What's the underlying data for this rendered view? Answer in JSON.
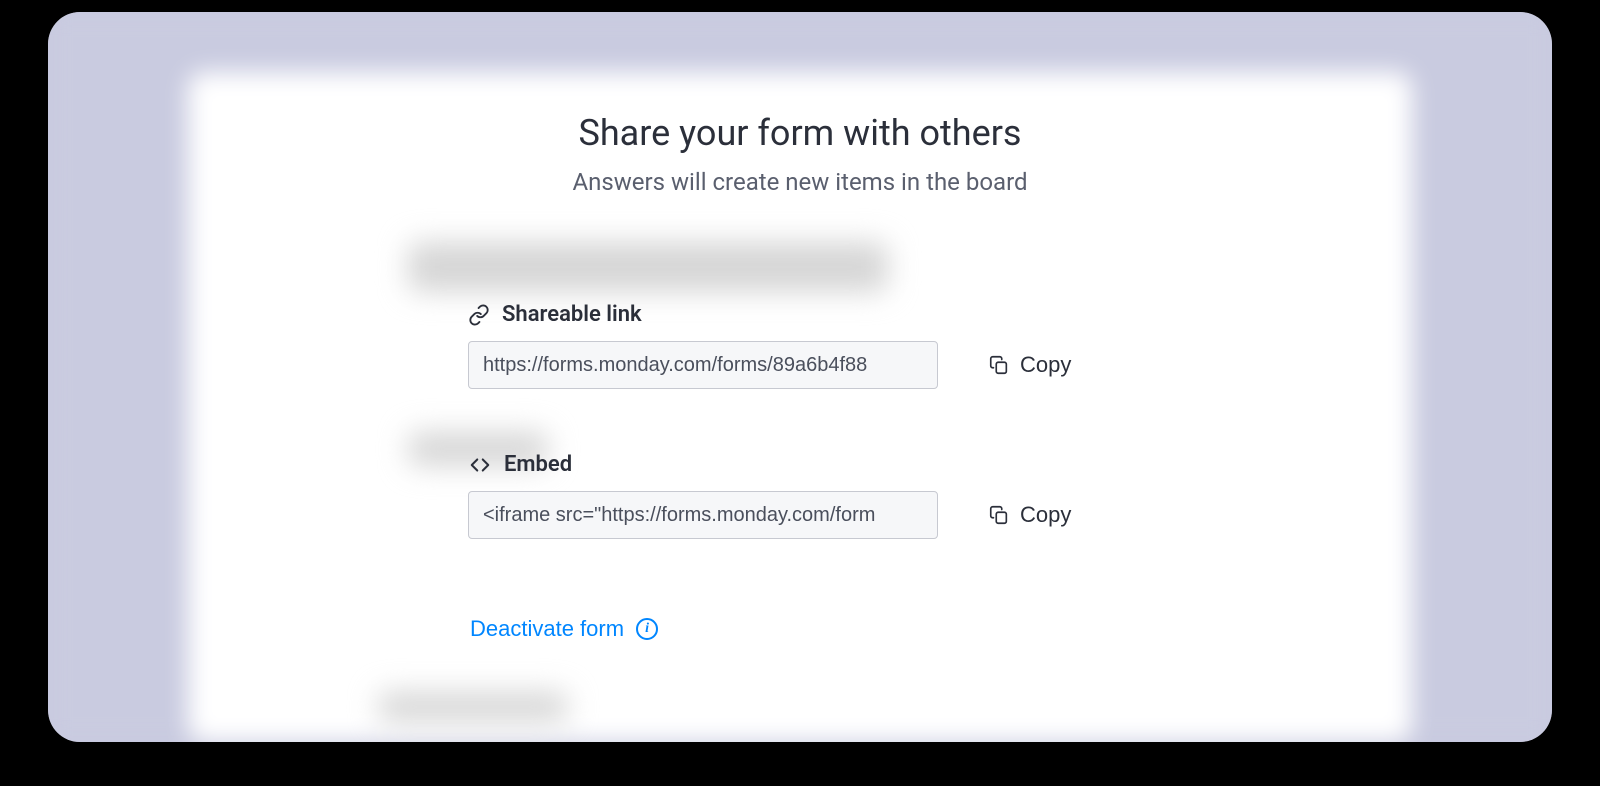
{
  "header": {
    "title": "Share your form with others",
    "subtitle": "Answers will create new items in the board"
  },
  "share": {
    "label": "Shareable link",
    "value": "https://forms.monday.com/forms/89a6b4f88",
    "copy_label": "Copy"
  },
  "embed": {
    "label": "Embed",
    "value": "<iframe src=\"https://forms.monday.com/form",
    "copy_label": "Copy"
  },
  "deactivate": {
    "label": "Deactivate form"
  },
  "colors": {
    "link": "#0086ff",
    "text": "#2b2f3a",
    "muted": "#5a5f6e",
    "bg": "#c9cbe0"
  }
}
